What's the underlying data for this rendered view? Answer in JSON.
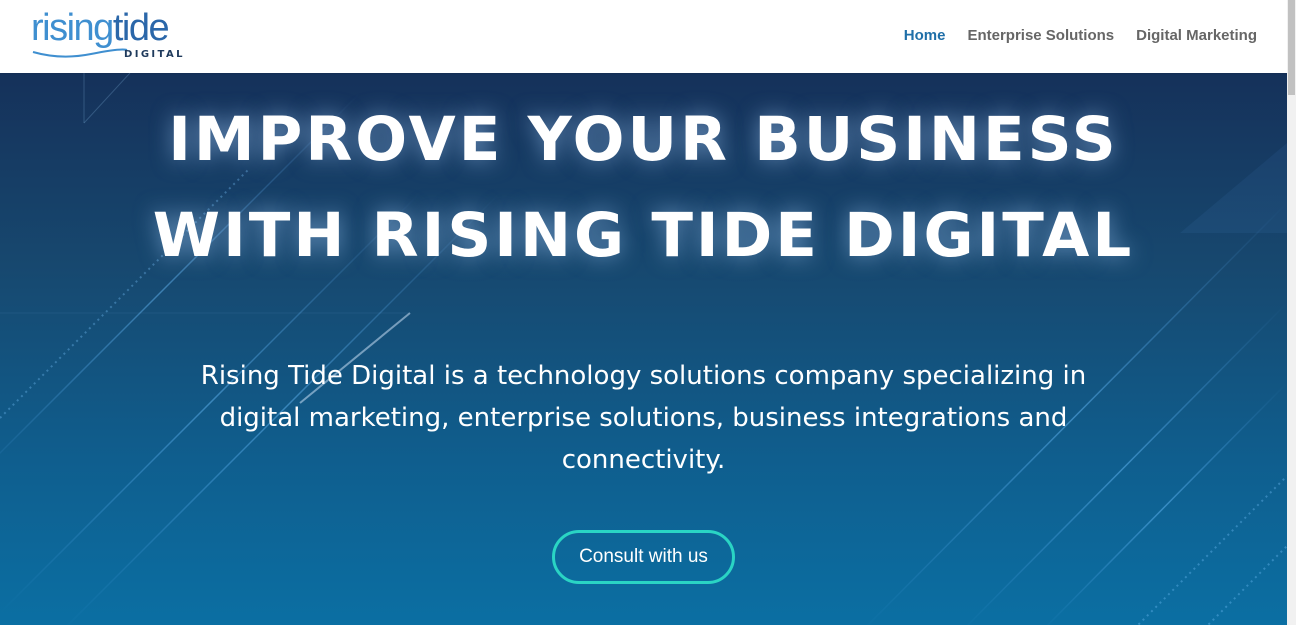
{
  "header": {
    "logo": {
      "word_part1": "rising",
      "word_part2": "tide",
      "subtitle": "DIGITAL"
    },
    "nav": [
      {
        "label": "Home",
        "active": true
      },
      {
        "label": "Enterprise Solutions",
        "active": false
      },
      {
        "label": "Digital Marketing",
        "active": false
      }
    ]
  },
  "hero": {
    "title_line1": "IMPROVE YOUR BUSINESS",
    "title_line2": "WITH RISING TIDE DIGITAL",
    "description": "Rising Tide Digital is a technology solutions company specializing in digital marketing, enterprise solutions, business integrations and connectivity.",
    "cta_label": "Consult with us"
  },
  "colors": {
    "nav_active": "#1f6fa8",
    "nav_default": "#666666",
    "hero_top": "#15315a",
    "hero_bottom": "#0b6fa3",
    "cta_border": "#2ad4c4",
    "logo_blue": "#3f8fd0"
  }
}
